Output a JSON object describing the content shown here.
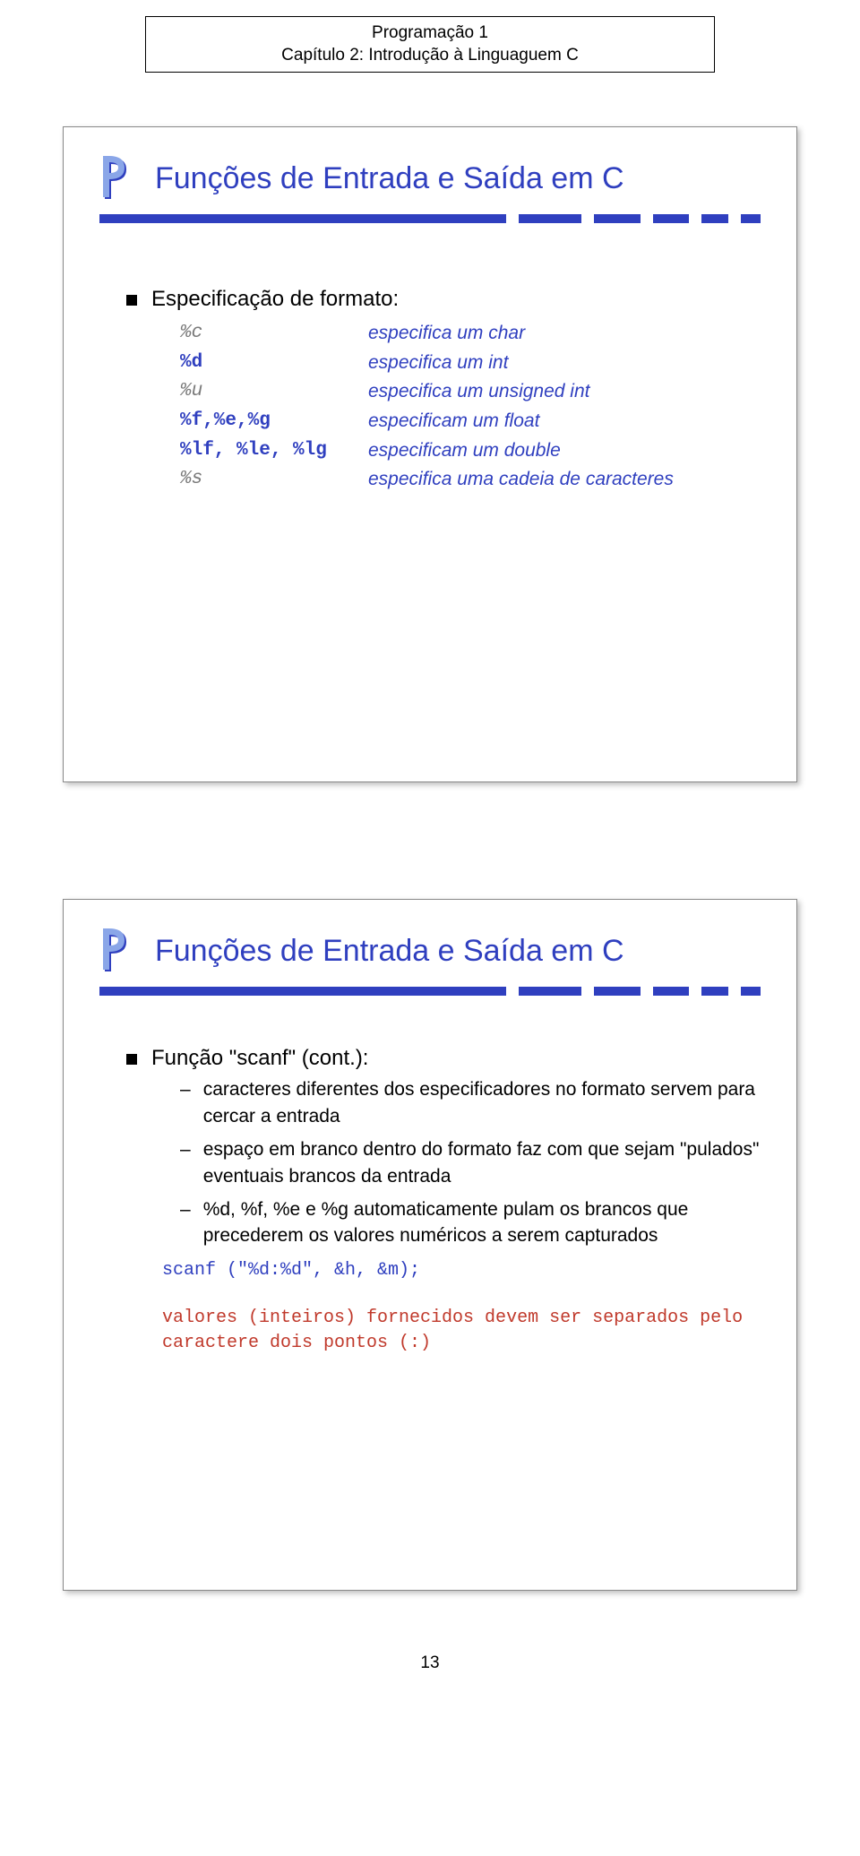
{
  "header": {
    "line1": "Programação 1",
    "line2": "Capítulo 2: Introdução à Linguaguem C"
  },
  "slide1": {
    "title": "Funções de Entrada e Saída em C",
    "bullet": "Especificação de formato:",
    "rows": [
      {
        "code": "%c",
        "desc": "especifica um char",
        "gray": true
      },
      {
        "code": "%d",
        "desc": "especifica um int",
        "gray": false
      },
      {
        "code": "%u",
        "desc": "especifica um unsigned int",
        "gray": true
      },
      {
        "code": "%f,%e,%g",
        "desc": "especificam um float",
        "gray": false
      },
      {
        "code": "%lf, %le, %lg",
        "desc": "especificam um double",
        "gray": false
      },
      {
        "code": "%s",
        "desc": "especifica uma cadeia de caracteres",
        "gray": true
      }
    ]
  },
  "slide2": {
    "title": "Funções de Entrada e Saída em C",
    "bullet": "Função \"scanf\" (cont.):",
    "items": [
      "caracteres diferentes dos especificadores no formato servem para cercar a entrada",
      "espaço em branco dentro do formato faz com que sejam \"pulados\" eventuais brancos da entrada",
      "%d, %f, %e e %g automaticamente pulam os brancos que precederem os valores numéricos a serem capturados"
    ],
    "code": "scanf (\"%d:%d\", &h, &m);",
    "note1": "valores (inteiros) fornecidos devem ser separados pelo",
    "note2": "caractere dois pontos (:)"
  },
  "pagenum": "13"
}
